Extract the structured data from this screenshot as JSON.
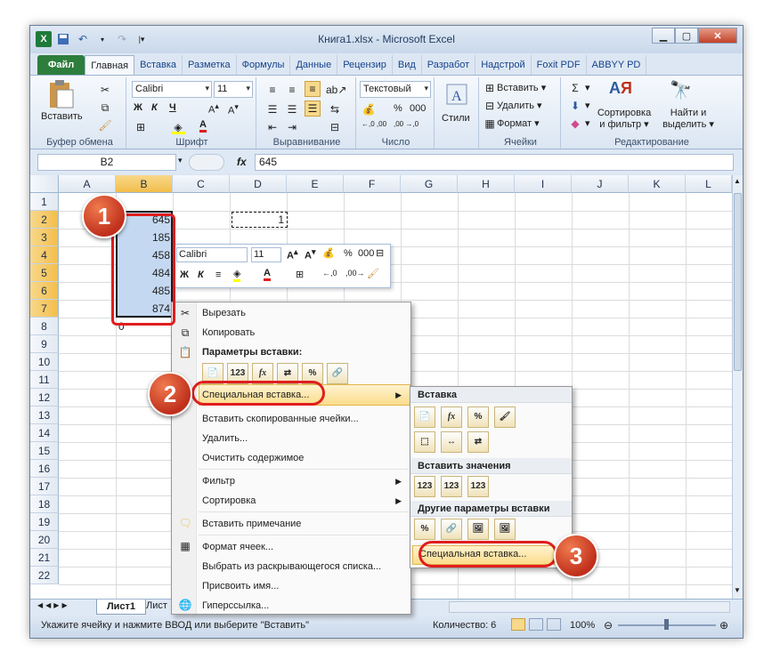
{
  "title": "Книга1.xlsx - Microsoft Excel",
  "tabs": [
    "Файл",
    "Главная",
    "Вставка",
    "Разметка",
    "Формулы",
    "Данные",
    "Рецензир",
    "Вид",
    "Разработ",
    "Надстрой",
    "Foxit PDF",
    "ABBYY PD"
  ],
  "ribbon": {
    "paste": "Вставить",
    "clipboard": "Буфер обмена",
    "font_name": "Calibri",
    "font_size": "11",
    "font_group": "Шрифт",
    "align_group": "Выравнивание",
    "number_format": "Текстовый",
    "number_group": "Число",
    "styles": "Стили",
    "insert": "Вставить",
    "delete": "Удалить",
    "format": "Формат",
    "cells_group": "Ячейки",
    "sort": "Сортировка",
    "sort2": "и фильтр",
    "find": "Найти и",
    "find2": "выделить",
    "editing_group": "Редактирование",
    "percent": "%",
    "thousands": "000",
    "dec_inc": "←,0 ,00",
    "dec_dec": ",00 →,0"
  },
  "formula_bar": {
    "name_box": "B2",
    "fx": "fx",
    "value": "645"
  },
  "columns": [
    "A",
    "B",
    "C",
    "D",
    "E",
    "F",
    "G",
    "H",
    "I",
    "J",
    "K",
    "L"
  ],
  "rows": [
    "1",
    "2",
    "3",
    "4",
    "5",
    "6",
    "7",
    "8",
    "9",
    "10",
    "11",
    "12",
    "13",
    "14",
    "15",
    "16",
    "17",
    "18",
    "19",
    "20",
    "21",
    "22"
  ],
  "cells": {
    "b2": "645",
    "b3": "185",
    "b4": "458",
    "b5": "484",
    "b6": "485",
    "b7": "874",
    "d2": "1",
    "b8": "0"
  },
  "mini_toolbar": {
    "font": "Calibri",
    "size": "11",
    "percent": "%",
    "thousands": "000"
  },
  "context_menu": {
    "cut": "Вырезать",
    "copy": "Копировать",
    "paste_options": "Параметры вставки:",
    "paste_special": "Специальная вставка...",
    "insert_copied": "Вставить скопированные ячейки...",
    "delete": "Удалить...",
    "clear": "Очистить содержимое",
    "filter": "Фильтр",
    "sort": "Сортировка",
    "insert_comment": "Вставить примечание",
    "format_cells": "Формат ячеек...",
    "pick_list": "Выбрать из раскрывающегося списка...",
    "name": "Присвоить имя...",
    "hyperlink": "Гиперссылка..."
  },
  "submenu": {
    "paste": "Вставка",
    "paste_values": "Вставить значения",
    "other": "Другие параметры вставки",
    "special": "Специальная вставка..."
  },
  "paste_icons": [
    "123",
    "fx",
    "%"
  ],
  "sheet": {
    "tab": "Лист1",
    "tab2": "Лист"
  },
  "status": {
    "message": "Укажите ячейку и нажмите ВВОД или выберите \"Вставить\"",
    "count": "Количество: 6",
    "zoom": "100%"
  },
  "badges": [
    "1",
    "2",
    "3"
  ]
}
